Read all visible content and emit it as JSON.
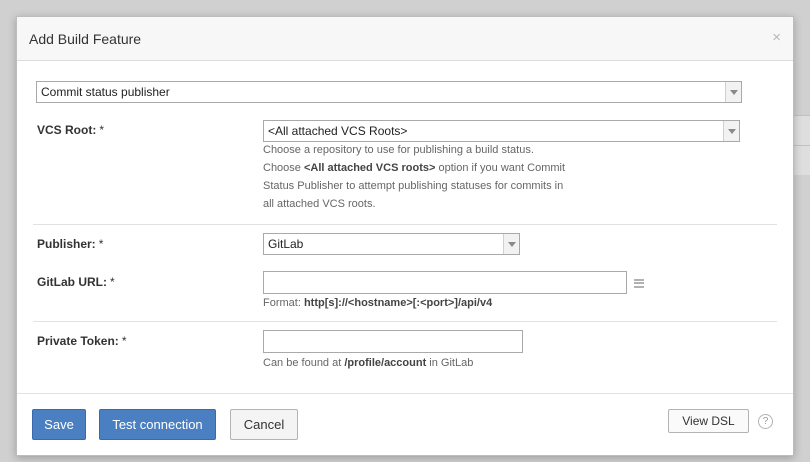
{
  "dialog": {
    "title": "Add Build Feature",
    "close_glyph": "×"
  },
  "feature_type": {
    "selected": "Commit status publisher"
  },
  "vcs_root": {
    "label": "VCS Root:",
    "required_mark": "*",
    "selected": "<All attached VCS Roots>",
    "help_line1": "Choose a repository to use for publishing a build status.",
    "help_line2_pre": "Choose ",
    "help_line2_bold": "<All attached VCS roots>",
    "help_line2_post": " option if you want Commit",
    "help_line3": "Status Publisher to attempt publishing statuses for commits in",
    "help_line4": "all attached VCS roots."
  },
  "publisher": {
    "label": "Publisher:",
    "required_mark": "*",
    "selected": "GitLab"
  },
  "gitlab_url": {
    "label": "GitLab URL:",
    "required_mark": "*",
    "value": "",
    "help_pre": "Format: ",
    "help_bold": "http[s]://<hostname>[:<port>]/api/v4"
  },
  "private_token": {
    "label": "Private Token:",
    "required_mark": "*",
    "value": "",
    "help_pre": "Can be found at ",
    "help_bold": "/profile/account",
    "help_post": " in GitLab"
  },
  "footer": {
    "save_label": "Save",
    "test_connection_label": "Test connection",
    "cancel_label": "Cancel",
    "view_dsl_label": "View DSL",
    "help_glyph": "?"
  },
  "colors": {
    "primary_button": "#4a7fc1",
    "dialog_header": "#f7f7f7",
    "backdrop": "#d0d0d0"
  },
  "icons": {
    "close": "close-icon",
    "dropdown": "chevron-down-icon",
    "editor": "text-editor-icon",
    "help": "help-icon"
  }
}
